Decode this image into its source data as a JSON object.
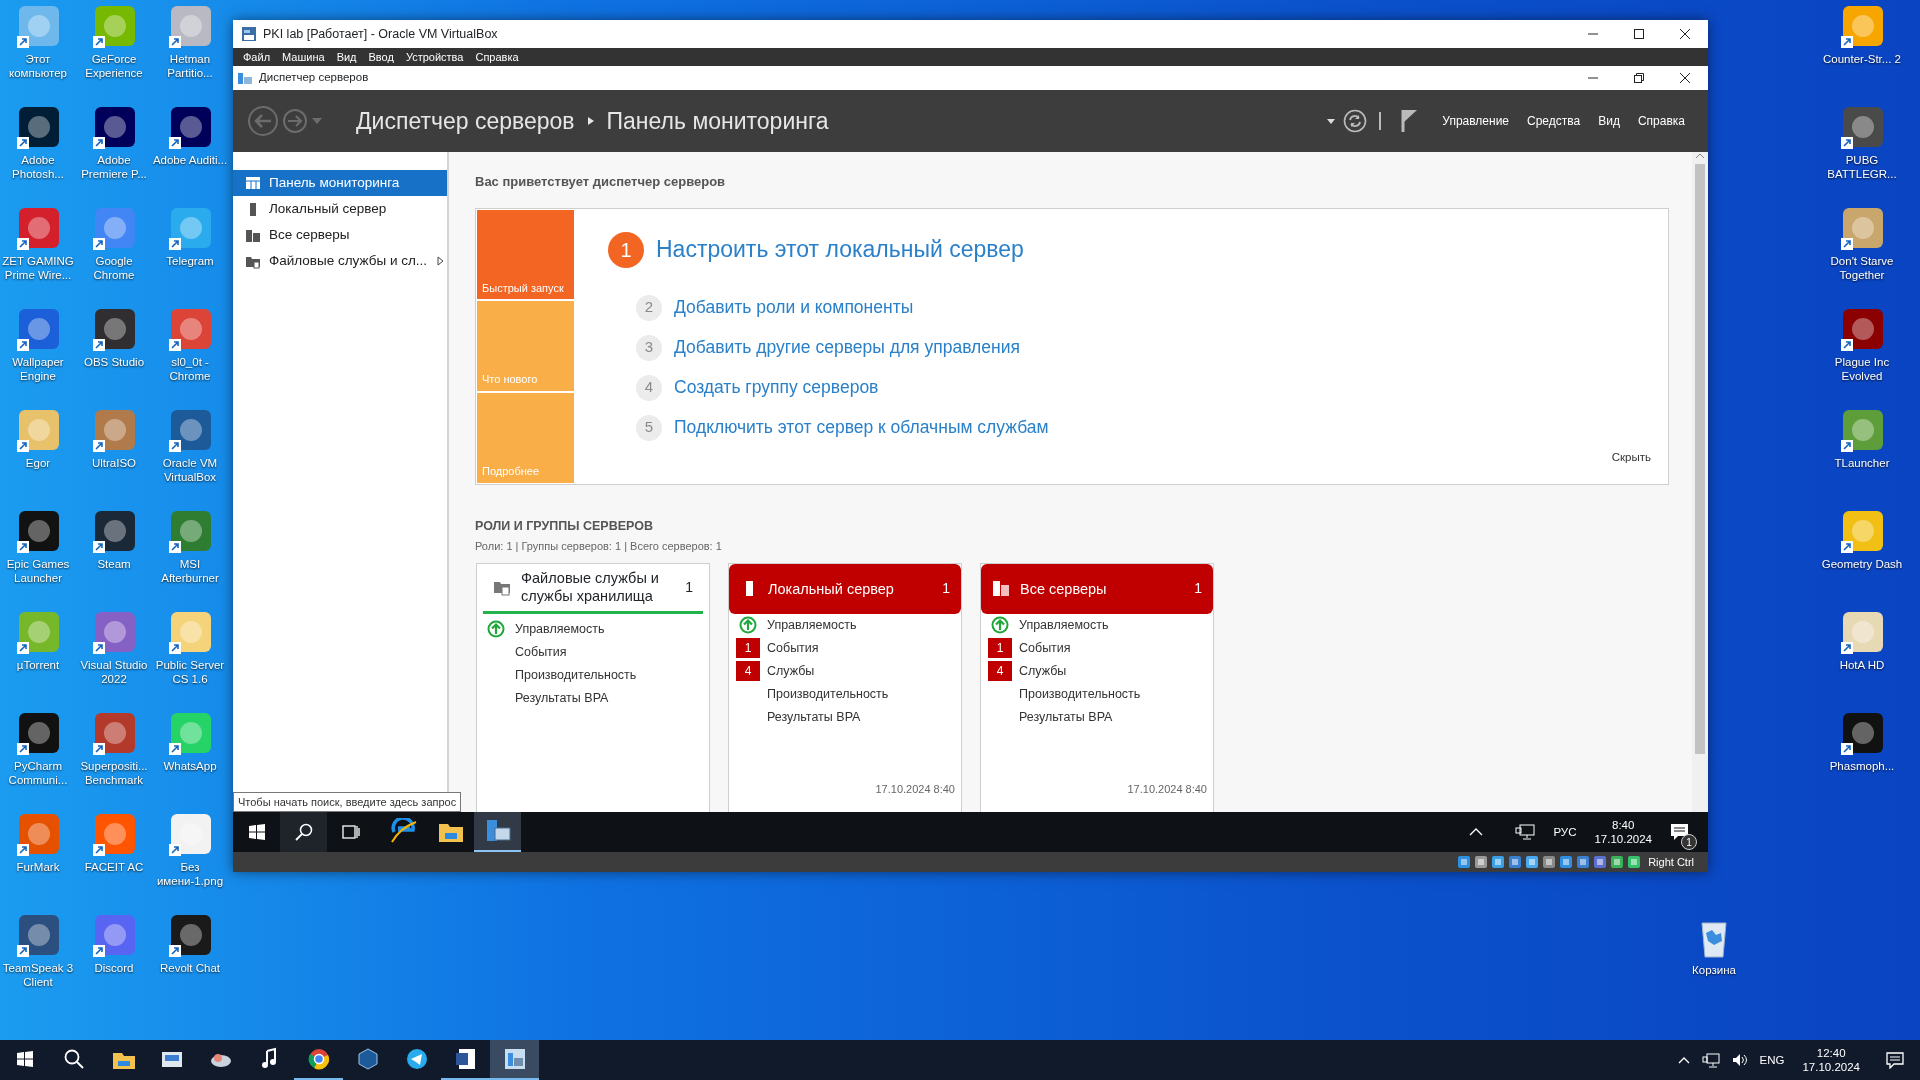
{
  "desktop_left": [
    {
      "label": "Этот компьютер",
      "color": "#6fb8ec"
    },
    {
      "label": "GeForce Experience",
      "color": "#76b900"
    },
    {
      "label": "Hetman Partitio...",
      "color": "#b9b9c4"
    },
    {
      "label": "Adobe Photosh...",
      "color": "#001e36"
    },
    {
      "label": "Adobe Premiere P...",
      "color": "#00005b"
    },
    {
      "label": "Adobe Auditi...",
      "color": "#00005b"
    },
    {
      "label": "ZET GAMING Prime Wire...",
      "color": "#d3202c"
    },
    {
      "label": "Google Chrome",
      "color": "#4285f4"
    },
    {
      "label": "Telegram",
      "color": "#2aabee"
    },
    {
      "label": "Wallpaper Engine",
      "color": "#1b5fd9"
    },
    {
      "label": "OBS Studio",
      "color": "#302e31"
    },
    {
      "label": "sl0_0t - Chrome",
      "color": "#db4437"
    },
    {
      "label": "Egor",
      "color": "#e8c26a"
    },
    {
      "label": "UltraISO",
      "color": "#b07a4a"
    },
    {
      "label": "Oracle VM VirtualBox",
      "color": "#1c5a9a"
    },
    {
      "label": "Epic Games Launcher",
      "color": "#121212"
    },
    {
      "label": "Steam",
      "color": "#1b2838"
    },
    {
      "label": "MSI Afterburner",
      "color": "#2e7d32"
    },
    {
      "label": "µTorrent",
      "color": "#76b82a"
    },
    {
      "label": "Visual Studio 2022",
      "color": "#8661c5"
    },
    {
      "label": "Public Server CS 1.6",
      "color": "#f4d37a"
    },
    {
      "label": "PyCharm Communi...",
      "color": "#111111"
    },
    {
      "label": "Superpositi... Benchmark",
      "color": "#b33a2a"
    },
    {
      "label": "WhatsApp",
      "color": "#25d366"
    },
    {
      "label": "FurMark",
      "color": "#e65100"
    },
    {
      "label": "FACEIT AC",
      "color": "#ff5500"
    },
    {
      "label": "Без имени-1.png",
      "color": "#f2f2f2"
    },
    {
      "label": "TeamSpeak 3 Client",
      "color": "#2b4f7e"
    },
    {
      "label": "Discord",
      "color": "#5865f2"
    },
    {
      "label": "Revolt Chat",
      "color": "#1a1a1a"
    }
  ],
  "desktop_right": [
    {
      "label": "Counter-Str... 2",
      "color": "#f7a600"
    },
    {
      "label": "PUBG BATTLEGR...",
      "color": "#4a4a4a"
    },
    {
      "label": "Don't Starve Together",
      "color": "#c9a66b"
    },
    {
      "label": "Plague Inc Evolved",
      "color": "#8b0000"
    },
    {
      "label": "TLauncher",
      "color": "#5e9e3a"
    },
    {
      "label": "Geometry Dash",
      "color": "#f2c014"
    },
    {
      "label": "HotA HD",
      "color": "#e8d9b5"
    },
    {
      "label": "Phasmoph...",
      "color": "#111111"
    }
  ],
  "recycle_bin": {
    "label": "Корзина"
  },
  "vbox": {
    "title": "PKI lab [Работает] - Oracle VM VirtualBox",
    "menu": [
      "Файл",
      "Машина",
      "Вид",
      "Ввод",
      "Устройства",
      "Справка"
    ],
    "host_key": "Right Ctrl"
  },
  "server_manager": {
    "title": "Диспетчер серверов",
    "breadcrumb": [
      "Диспетчер серверов",
      "Панель мониторинга"
    ],
    "menu": [
      "Управление",
      "Средства",
      "Вид",
      "Справка"
    ],
    "sidebar": [
      {
        "label": "Панель мониторинга",
        "selected": true,
        "expandable": false
      },
      {
        "label": "Локальный сервер",
        "selected": false,
        "expandable": false
      },
      {
        "label": "Все серверы",
        "selected": false,
        "expandable": false
      },
      {
        "label": "Файловые службы и сл...",
        "selected": false,
        "expandable": true
      }
    ],
    "welcome": {
      "heading": "Вас приветствует диспетчер серверов",
      "tiles": [
        {
          "label": "Быстрый запуск",
          "selected": true
        },
        {
          "label": "Что нового",
          "selected": false
        },
        {
          "label": "Подробнее",
          "selected": false
        }
      ],
      "steps": [
        {
          "number": "1",
          "label": "Настроить этот локальный сервер",
          "highlighted": true
        },
        {
          "number": "2",
          "label": "Добавить роли и компоненты",
          "highlighted": false
        },
        {
          "number": "3",
          "label": "Добавить другие серверы для управления",
          "highlighted": false
        },
        {
          "number": "4",
          "label": "Создать группу серверов",
          "highlighted": false
        },
        {
          "number": "5",
          "label": "Подключить этот сервер к облачным службам",
          "highlighted": false
        }
      ],
      "hide": "Скрыть"
    },
    "roles": {
      "heading": "РОЛИ И ГРУППЫ СЕРВЕРОВ",
      "summary": "Роли: 1 | Группы серверов: 1 | Всего серверов: 1",
      "cards": [
        {
          "title": "Файловые службы и службы хранилища",
          "count": "1",
          "alert": false,
          "rows": [
            {
              "label": "Управляемость",
              "ok": true
            },
            {
              "label": "События",
              "ok": false
            },
            {
              "label": "Производительность",
              "ok": false
            },
            {
              "label": "Результаты BPA",
              "ok": false
            }
          ]
        },
        {
          "title": "Локальный сервер",
          "count": "1",
          "alert": true,
          "rows": [
            {
              "label": "Управляемость",
              "ok": true
            },
            {
              "label": "События",
              "ok": false,
              "badge": "1"
            },
            {
              "label": "Службы",
              "ok": false,
              "badge": "4"
            },
            {
              "label": "Производительность",
              "ok": false
            },
            {
              "label": "Результаты BPA",
              "ok": false
            }
          ],
          "timestamp": "17.10.2024 8:40"
        },
        {
          "title": "Все серверы",
          "count": "1",
          "alert": true,
          "rows": [
            {
              "label": "Управляемость",
              "ok": true
            },
            {
              "label": "События",
              "ok": false,
              "badge": "1"
            },
            {
              "label": "Службы",
              "ok": false,
              "badge": "4"
            },
            {
              "label": "Производительность",
              "ok": false
            },
            {
              "label": "Результаты BPA",
              "ok": false
            }
          ],
          "timestamp": "17.10.2024 8:40"
        }
      ]
    }
  },
  "guest_taskbar": {
    "search_tooltip": "Чтобы начать поиск, введите здесь запрос",
    "apps": [
      {
        "selected": false
      },
      {
        "selected": false
      },
      {
        "selected": true
      }
    ],
    "language": "РУС",
    "time": "8:40",
    "date": "17.10.2024",
    "notifications": "1"
  },
  "host_taskbar": {
    "apps": [
      {
        "running": false,
        "selected": false
      },
      {
        "running": false,
        "selected": false
      },
      {
        "running": false,
        "selected": false
      },
      {
        "running": false,
        "selected": false
      },
      {
        "running": true,
        "selected": false
      },
      {
        "running": false,
        "selected": false
      },
      {
        "running": false,
        "selected": false
      },
      {
        "running": true,
        "selected": false
      },
      {
        "running": true,
        "selected": true
      }
    ],
    "language": "ENG",
    "time": "12:40",
    "date": "17.10.2024"
  }
}
